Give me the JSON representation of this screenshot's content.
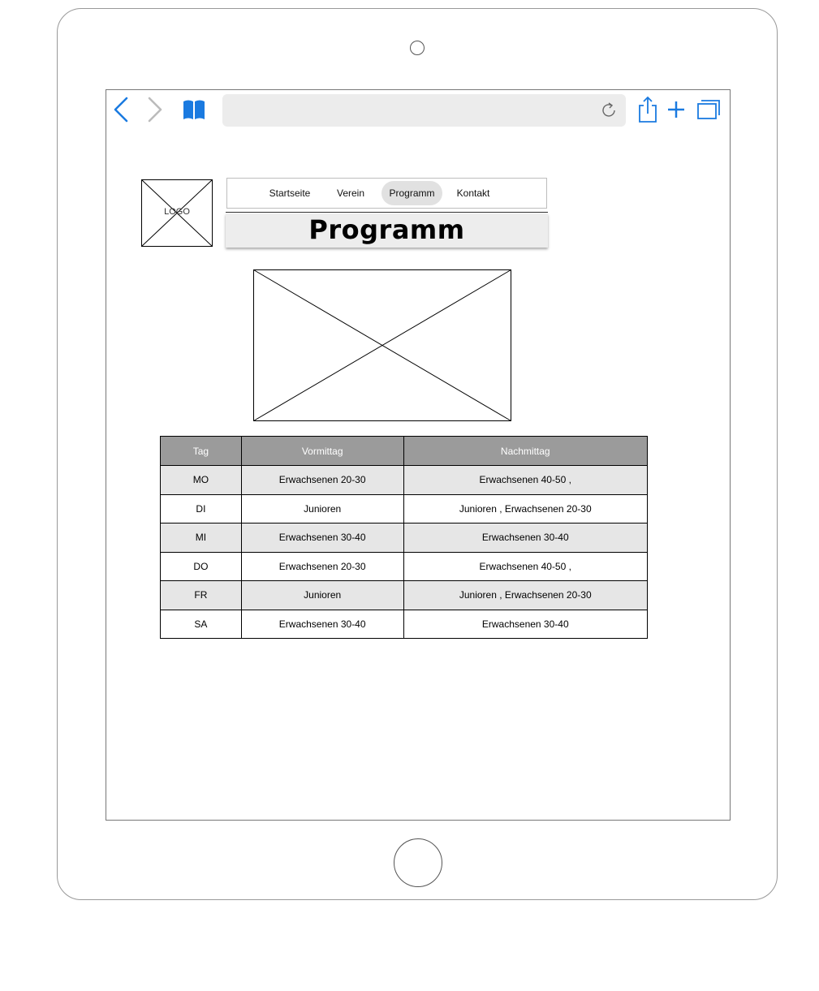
{
  "browser": {
    "url": ""
  },
  "logo": {
    "text": "LOGO"
  },
  "nav": {
    "items": [
      {
        "label": "Startseite",
        "active": false
      },
      {
        "label": "Verein",
        "active": false
      },
      {
        "label": "Programm",
        "active": true
      },
      {
        "label": "Kontakt",
        "active": false
      }
    ]
  },
  "page": {
    "title": "Programm"
  },
  "schedule": {
    "headers": [
      "Tag",
      "Vormittag",
      "Nachmittag"
    ],
    "rows": [
      {
        "day": "MO",
        "morning": "Erwachsenen 20-30",
        "afternoon": "Erwachsenen 40-50 ,"
      },
      {
        "day": "DI",
        "morning": "Junioren",
        "afternoon": "Junioren , Erwachsenen 20-30"
      },
      {
        "day": "MI",
        "morning": "Erwachsenen 30-40",
        "afternoon": "Erwachsenen 30-40"
      },
      {
        "day": "DO",
        "morning": "Erwachsenen 20-30",
        "afternoon": "Erwachsenen 40-50 ,"
      },
      {
        "day": "FR",
        "morning": "Junioren",
        "afternoon": "Junioren , Erwachsenen 20-30"
      },
      {
        "day": "SA",
        "morning": "Erwachsenen 30-40",
        "afternoon": "Erwachsenen 30-40"
      }
    ]
  },
  "colors": {
    "accent": "#1a7ae0",
    "header_bg": "#9b9b9b",
    "row_shade": "#e6e6e6"
  }
}
